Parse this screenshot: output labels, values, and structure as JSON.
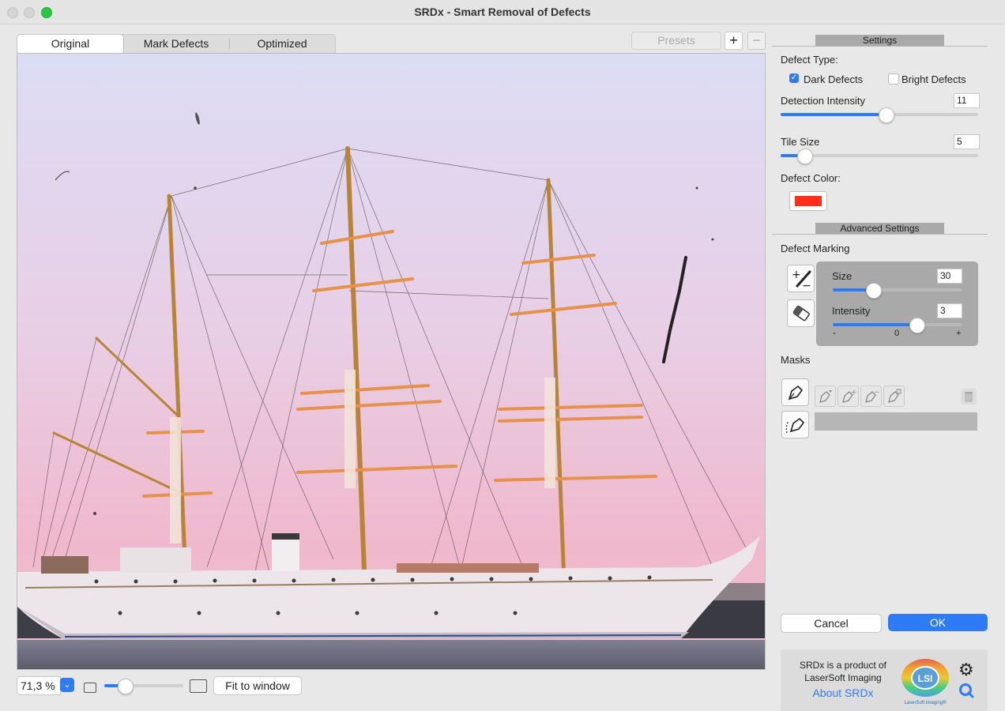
{
  "window": {
    "title": "SRDx - Smart Removal of Defects"
  },
  "tabs": [
    {
      "label": "Original"
    },
    {
      "label": "Mark Defects"
    },
    {
      "label": "Optimized"
    }
  ],
  "presets": {
    "label": "Presets",
    "add": "+",
    "remove": "−"
  },
  "bottom": {
    "zoom_value": "71,3 %",
    "zoom_slider": 0.26,
    "fit_label": "Fit to window"
  },
  "settings": {
    "header": "Settings",
    "defect_type_label": "Defect Type:",
    "dark_defects": {
      "label": "Dark Defects",
      "checked": true
    },
    "bright_defects": {
      "label": "Bright Defects",
      "checked": false
    },
    "detection_intensity": {
      "label": "Detection Intensity",
      "value": "11",
      "fraction": 0.53
    },
    "tile_size": {
      "label": "Tile Size",
      "value": "5",
      "fraction": 0.12
    },
    "defect_color_label": "Defect Color:",
    "defect_color": "#ff2d1a"
  },
  "advanced": {
    "header": "Advanced Settings",
    "defect_marking_label": "Defect Marking",
    "size": {
      "label": "Size",
      "value": "30",
      "fraction": 0.31
    },
    "intensity": {
      "label": "Intensity",
      "value": "3",
      "fraction": 0.65
    },
    "scale": {
      "minus": "-",
      "zero": "0",
      "plus": "+"
    }
  },
  "masks": {
    "label": "Masks"
  },
  "actions": {
    "cancel": "Cancel",
    "ok": "OK"
  },
  "about": {
    "product_line1": "SRDx is a product of",
    "product_line2": "LaserSoft Imaging",
    "about_link": "About SRDx",
    "logo_text": "LSI",
    "logo_caption": "LaserSoft Imaging®"
  },
  "colors": {
    "accent": "#2f7bf5",
    "close": "#d0d0d0",
    "zoom": "#28c840"
  }
}
